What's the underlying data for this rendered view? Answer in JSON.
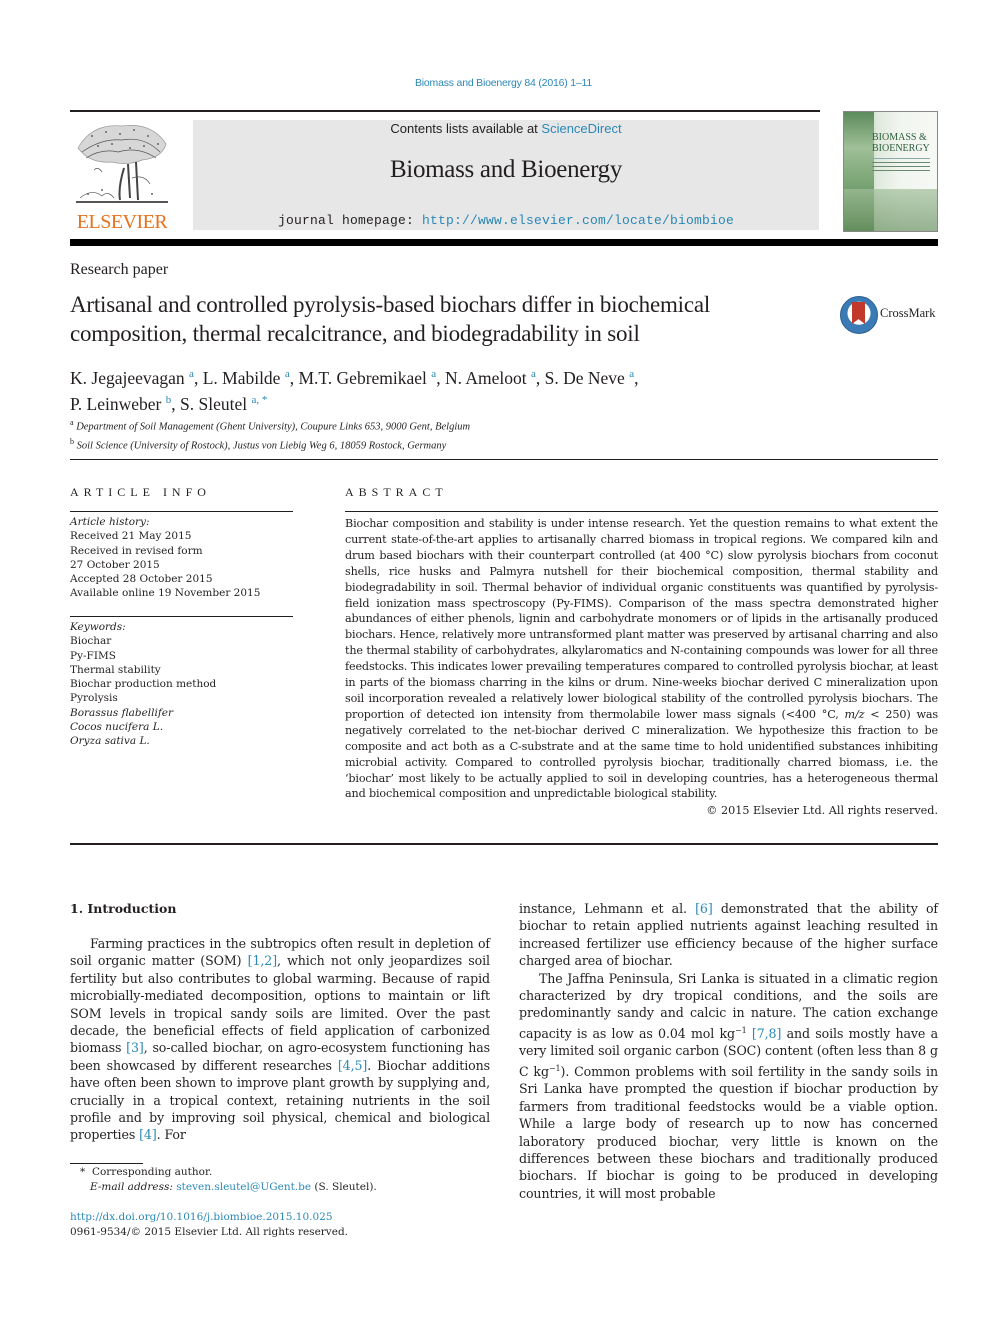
{
  "header": {
    "journal_ref": "Biomass and Bioenergy 84 (2016) 1–11",
    "contents_prefix": "Contents lists available at ",
    "contents_link": "ScienceDirect",
    "journal_title": "Biomass and Bioenergy",
    "homepage_prefix": "journal homepage: ",
    "homepage_url": "http://www.elsevier.com/locate/biombioe",
    "publisher_logo_text": "ELSEVIER",
    "cover_title_line1": "BIOMASS &",
    "cover_title_line2": "BIOENERGY",
    "crossmark_label": "CrossMark"
  },
  "article": {
    "type": "Research paper",
    "title": "Artisanal and controlled pyrolysis-based biochars differ in biochemical composition, thermal recalcitrance, and biodegradability in soil",
    "authors": [
      {
        "name": "K. Jegajeevagan",
        "aff": "a",
        "sep": ", "
      },
      {
        "name": "L. Mabilde",
        "aff": "a",
        "sep": ", "
      },
      {
        "name": "M.T. Gebremikael",
        "aff": "a",
        "sep": ", "
      },
      {
        "name": "N. Ameloot",
        "aff": "a",
        "sep": ", "
      },
      {
        "name": "S. De Neve",
        "aff": "a",
        "sep": ","
      },
      {
        "name": "P. Leinweber",
        "aff": "b",
        "sep": ", "
      },
      {
        "name": "S. Sleutel",
        "aff": "a, *",
        "sep": ""
      }
    ],
    "affiliations": [
      {
        "key": "a",
        "text": "Department of Soil Management (Ghent University), Coupure Links 653, 9000 Gent, Belgium"
      },
      {
        "key": "b",
        "text": "Soil Science (University of Rostock), Justus von Liebig Weg 6, 18059 Rostock, Germany"
      }
    ]
  },
  "article_info": {
    "heading": "ARTICLE INFO",
    "history_label": "Article history:",
    "history": [
      "Received 21 May 2015",
      "Received in revised form",
      "27 October 2015",
      "Accepted 28 October 2015",
      "Available online 19 November 2015"
    ],
    "keywords_label": "Keywords:",
    "keywords": [
      {
        "text": "Biochar",
        "italic": false
      },
      {
        "text": "Py-FIMS",
        "italic": false
      },
      {
        "text": "Thermal stability",
        "italic": false
      },
      {
        "text": "Biochar production method",
        "italic": false
      },
      {
        "text": "Pyrolysis",
        "italic": false
      },
      {
        "text": "Borassus flabellifer",
        "italic": true
      },
      {
        "text": "Cocos nucifera L.",
        "italic": true
      },
      {
        "text": "Oryza sativa L.",
        "italic": true
      }
    ]
  },
  "abstract": {
    "heading": "ABSTRACT",
    "part1": "Biochar composition and stability is under intense research. Yet the question remains to what extent the current state-of-the-art applies to artisanally charred biomass in tropical regions. We compared kiln and drum based biochars with their counterpart controlled (at 400 °C) slow pyrolysis biochars from coconut shells, rice husks and Palmyra nutshell for their biochemical composition, thermal stability and biodegradability in soil. Thermal behavior of individual organic constituents was quantified by pyrolysis-field ionization mass spectroscopy (Py-FIMS). Comparison of the mass spectra demonstrated higher abundances of either phenols, lignin and carbohydrate monomers or of lipids in the artisanally produced biochars. Hence, relatively more untransformed plant matter was preserved by artisanal charring and also the thermal stability of carbohydrates, alkylaromatics and N-containing compounds was lower for all three feedstocks. This indicates lower prevailing temperatures compared to controlled pyrolysis biochar, at least in parts of the biomass charring in the kilns or drum. Nine-weeks biochar derived C mineralization upon soil incorporation revealed a relatively lower biological stability of the controlled pyrolysis biochars. The proportion of detected ion intensity from thermolabile lower mass signals (<400 °C, ",
    "mz": "m/z",
    "part2": " < 250) was negatively correlated to the net-biochar derived C mineralization. We hypothesize this fraction to be composite and act both as a C-substrate and at the same time to hold unidentified substances inhibiting microbial activity. Compared to controlled pyrolysis biochar, traditionally charred biomass, i.e. the ‘biochar’ most likely to be actually applied to soil in developing countries, has a heterogeneous thermal and biochemical composition and unpredictable biological stability.",
    "copyright": "© 2015 Elsevier Ltd. All rights reserved."
  },
  "introduction": {
    "heading": "1.  Introduction",
    "col1": [
      {
        "t": "Farming practices in the subtropics often result in depletion of soil organic matter (SOM) "
      },
      {
        "ref": "[1,2]"
      },
      {
        "t": ", which not only jeopardizes soil fertility but also contributes to global warming. Because of rapid microbially-mediated decomposition, options to maintain or lift SOM levels in tropical sandy soils are limited. Over the past decade, the beneficial effects of field application of carbonized biomass "
      },
      {
        "ref": "[3]"
      },
      {
        "t": ", so-called biochar, on agro-ecosystem functioning has been showcased by different researches "
      },
      {
        "ref": "[4,5]"
      },
      {
        "t": ". Biochar additions have often been shown to improve plant growth by supplying and, crucially in a tropical context, retaining nutrients in the soil profile and by improving soil physical, chemical and biological properties "
      },
      {
        "ref": "[4]"
      },
      {
        "t": ". For"
      }
    ],
    "col2_p1": [
      {
        "t": "instance, Lehmann et al. "
      },
      {
        "ref": "[6]"
      },
      {
        "t": " demonstrated that the ability of biochar to retain applied nutrients against leaching resulted in increased fertilizer use efficiency because of the higher surface charged area of biochar."
      }
    ],
    "col2_p2": [
      {
        "t": "The Jaffna Peninsula, Sri Lanka is situated in a climatic region characterized by dry tropical conditions, and the soils are predominantly sandy and calcic in nature. The cation exchange capacity is as low as 0.04 mol kg"
      },
      {
        "sup": "−1"
      },
      {
        "t": " "
      },
      {
        "ref": "[7,8]"
      },
      {
        "t": " and soils mostly have a very limited soil organic carbon (SOC) content (often less than 8 g C kg"
      },
      {
        "sup": "−1"
      },
      {
        "t": "). Common problems with soil fertility in the sandy soils in Sri Lanka have prompted the question if biochar production by farmers from traditional feedstocks would be a viable option. While a large body of research up to now has concerned laboratory produced biochar, very little is known on the differences between these biochars and traditionally produced biochars. If biochar is going to be produced in developing countries, it will most probable"
      }
    ]
  },
  "footnote": {
    "marker": "*",
    "corresponding": "Corresponding author.",
    "email_label": "E-mail address: ",
    "email": "steven.sleutel@UGent.be",
    "email_suffix": " (S. Sleutel).",
    "doi_url": "http://dx.doi.org/10.1016/j.biombioe.2015.10.025",
    "issn_line": "0961-9534/© 2015 Elsevier Ltd. All rights reserved."
  }
}
